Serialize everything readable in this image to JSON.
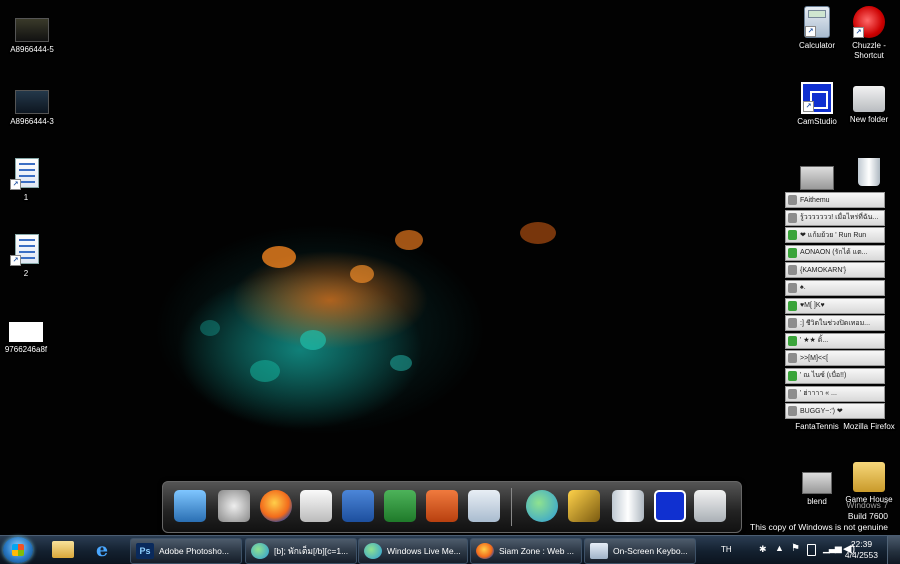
{
  "desktop_icons_left": [
    {
      "name": "image-file-a8966444-5",
      "label": "A8966444-5",
      "icon": "image-thumbnail-icon"
    },
    {
      "name": "image-file-a8966444-3",
      "label": "A8966444-3",
      "icon": "image-thumbnail-icon"
    },
    {
      "name": "document-1",
      "label": "1",
      "icon": "document-icon"
    },
    {
      "name": "document-2",
      "label": "2",
      "icon": "document-icon"
    },
    {
      "name": "image-file-9766246a8f",
      "label": "9766246a8f",
      "icon": "image-thumbnail-icon"
    }
  ],
  "desktop_icons_right": [
    {
      "name": "calculator",
      "label": "Calculator",
      "icon": "calculator-icon"
    },
    {
      "name": "chuzzle-shortcut",
      "label": "Chuzzle - Shortcut",
      "icon": "chuzzle-icon"
    },
    {
      "name": "camstudio",
      "label": "CamStudio",
      "icon": "camstudio-icon"
    },
    {
      "name": "new-folder",
      "label": "New folder",
      "icon": "folder-icon"
    },
    {
      "name": "video-file",
      "label": "FAithemu",
      "icon": "video-file-icon"
    },
    {
      "name": "recycle-bin",
      "label": "Recycle Bin",
      "icon": "recycle-bin-icon"
    },
    {
      "name": "fantatennis",
      "label": "FantaTennis",
      "icon": "fantatennis-icon"
    },
    {
      "name": "mozilla-firefox",
      "label": "Mozilla Firefox",
      "icon": "firefox-icon"
    },
    {
      "name": "blend",
      "label": "blend",
      "icon": "video-file-icon"
    },
    {
      "name": "game-house",
      "label": "Game House",
      "icon": "folder-icon"
    }
  ],
  "contacts": [
    {
      "text": "FAithemu",
      "online": false
    },
    {
      "text": "รู้ววววววว! เมื่อไหร่ที่ฉัน...",
      "online": false
    },
    {
      "text": "❤ แก้มย้วย ' Run Run",
      "online": true
    },
    {
      "text": "AONAON (รักได้ แต...",
      "online": true
    },
    {
      "text": "{KAMOKARN'}",
      "online": false
    },
    {
      "text": "♠.",
      "online": false
    },
    {
      "text": "♥M[ ]K♥",
      "online": true
    },
    {
      "text": ":] ชีวิตในช่วงปิดเทอม...",
      "online": false
    },
    {
      "text": "' ★★ ดิ้...",
      "online": true
    },
    {
      "text": ">>[M]<<[",
      "online": false
    },
    {
      "text": "' ณ ไนซ์ (เบื่อ!!)",
      "online": true
    },
    {
      "text": "' ฮ่าาาา « ...",
      "online": false
    },
    {
      "text": "BUGGY~:') ❤",
      "online": false
    }
  ],
  "dock_items": [
    {
      "name": "network",
      "icon": "network-computers-icon"
    },
    {
      "name": "settings",
      "icon": "gear-panel-icon"
    },
    {
      "name": "firefox",
      "icon": "firefox-icon"
    },
    {
      "name": "ipod",
      "icon": "ipod-icon"
    },
    {
      "name": "word",
      "icon": "word-icon"
    },
    {
      "name": "excel",
      "icon": "excel-icon"
    },
    {
      "name": "powerpoint",
      "icon": "powerpoint-icon"
    },
    {
      "name": "calculator",
      "icon": "calculator-icon"
    },
    {
      "name": "messenger",
      "icon": "messenger-icon"
    },
    {
      "name": "tools",
      "icon": "hammer-tools-icon"
    },
    {
      "name": "recycle-bin",
      "icon": "recycle-bin-icon"
    },
    {
      "name": "camstudio",
      "icon": "camstudio-icon"
    },
    {
      "name": "folder",
      "icon": "folder-icon"
    }
  ],
  "taskbar": {
    "pinned": [
      {
        "name": "explorer",
        "icon": "folder-library-icon"
      },
      {
        "name": "internet-explorer",
        "icon": "ie-icon"
      }
    ],
    "windows": [
      {
        "label": "Adobe Photosho...",
        "icon": "photoshop-icon"
      },
      {
        "label": "[b]; พักเต็ม[/b][c=1...",
        "icon": "messenger-icon"
      },
      {
        "label": "Windows Live Me...",
        "icon": "messenger-icon"
      },
      {
        "label": "Siam Zone : Web ...",
        "icon": "firefox-icon"
      },
      {
        "label": "On-Screen Keybo...",
        "icon": "keyboard-icon"
      }
    ],
    "language": "TH",
    "time": "22:39",
    "date": "4/4/2553"
  },
  "genuine_notice": {
    "line1": "Windows 7",
    "line2": "Build 7600",
    "line3": "This copy of Windows is not genuine"
  },
  "colors": {
    "taskbar": "#13202f",
    "dock": "#333333",
    "wallpaper_orange": "#e66e14",
    "wallpaper_teal": "#14a096"
  }
}
